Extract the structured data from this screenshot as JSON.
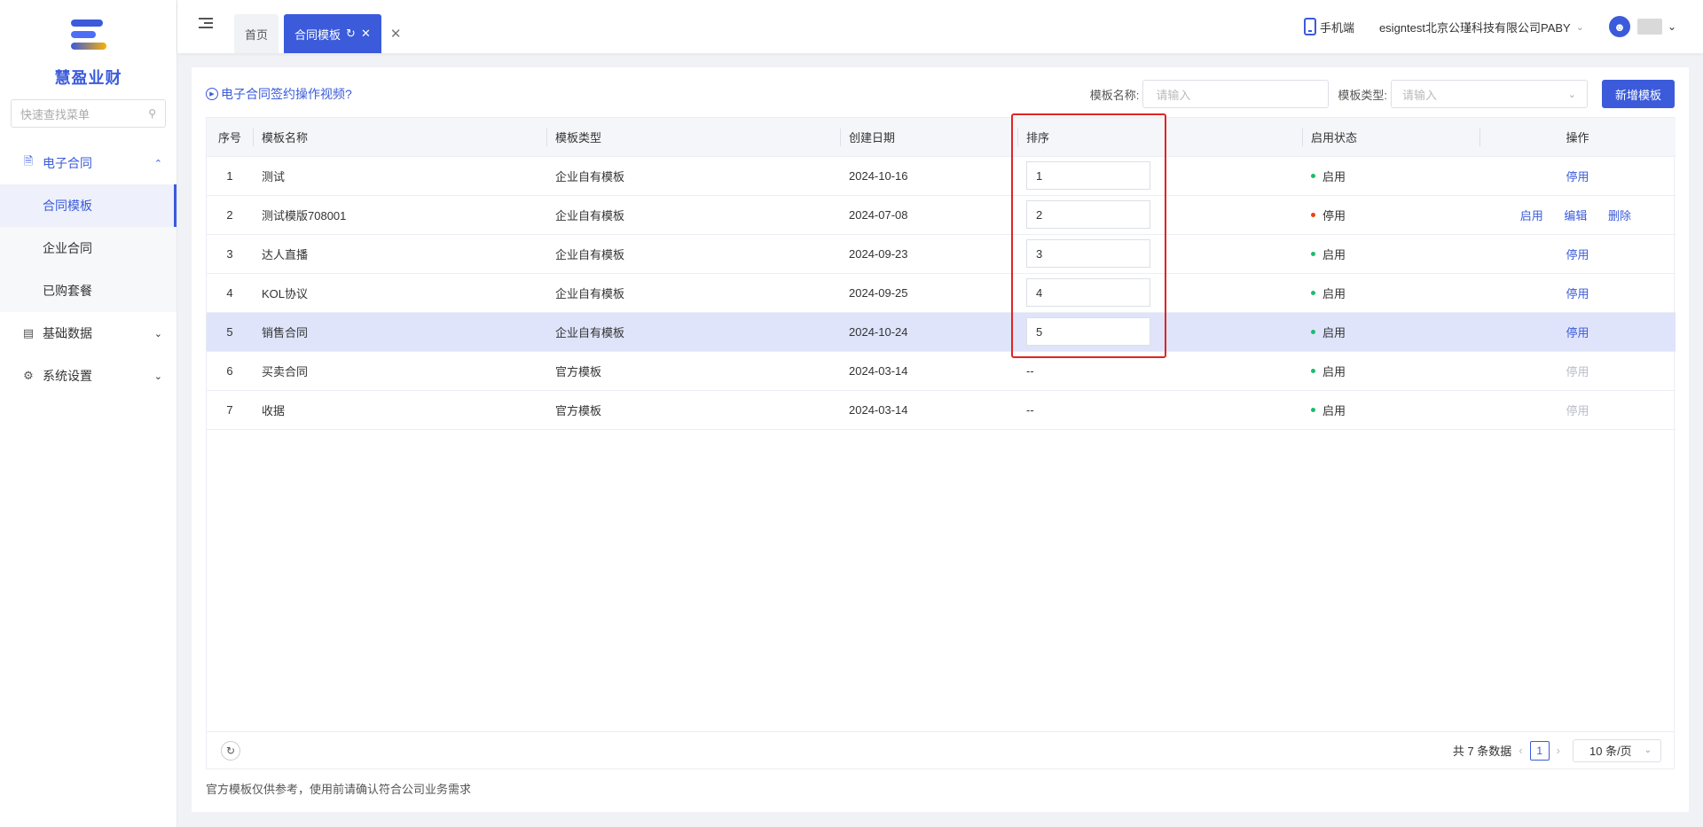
{
  "app": {
    "name": "慧盈业财",
    "search_placeholder": "快速查找菜单"
  },
  "sidebar": {
    "items": [
      {
        "label": "电子合同",
        "icon": "contract-icon",
        "open": true,
        "children": [
          {
            "label": "合同模板",
            "active": true
          },
          {
            "label": "企业合同"
          },
          {
            "label": "已购套餐"
          }
        ]
      },
      {
        "label": "基础数据",
        "icon": "document-icon",
        "open": false
      },
      {
        "label": "系统设置",
        "icon": "gear-icon",
        "open": false
      }
    ]
  },
  "header": {
    "tabs": [
      {
        "label": "首页"
      },
      {
        "label": "合同模板",
        "active": true
      }
    ],
    "mobile_label": "手机端",
    "company": "esigntest北京公瑾科技有限公司PABY"
  },
  "toolbar": {
    "video_link": "电子合同签约操作视频?",
    "name_label": "模板名称:",
    "name_placeholder": "请输入",
    "type_label": "模板类型:",
    "type_placeholder": "请输入",
    "add_button": "新增模板"
  },
  "table": {
    "columns": [
      "序号",
      "模板名称",
      "模板类型",
      "创建日期",
      "排序",
      "启用状态",
      "操作"
    ],
    "rows": [
      {
        "index": "1",
        "name": "测试",
        "type": "企业自有模板",
        "date": "2024-10-16",
        "sort": "1",
        "status": "启用",
        "status_color": "#19be6b"
      },
      {
        "index": "2",
        "name": "测试模版708001",
        "type": "企业自有模板",
        "date": "2024-07-08",
        "sort": "2",
        "status": "停用",
        "status_color": "#ed4014"
      },
      {
        "index": "3",
        "name": "达人直播",
        "type": "企业自有模板",
        "date": "2024-09-23",
        "sort": "3",
        "status": "启用",
        "status_color": "#19be6b"
      },
      {
        "index": "4",
        "name": "KOL协议",
        "type": "企业自有模板",
        "date": "2024-09-25",
        "sort": "4",
        "status": "启用",
        "status_color": "#19be6b"
      },
      {
        "index": "5",
        "name": "销售合同",
        "type": "企业自有模板",
        "date": "2024-10-24",
        "sort": "5",
        "status": "启用",
        "status_color": "#19be6b"
      },
      {
        "index": "6",
        "name": "买卖合同",
        "type": "官方模板",
        "date": "2024-03-14",
        "sort": "--",
        "status": "启用",
        "status_color": "#19be6b"
      },
      {
        "index": "7",
        "name": "收据",
        "type": "官方模板",
        "date": "2024-03-14",
        "sort": "--",
        "status": "启用",
        "status_color": "#19be6b"
      }
    ],
    "actions": {
      "enable": "启用",
      "edit": "编辑",
      "delete": "删除",
      "disable": "停用"
    }
  },
  "pager": {
    "total_text": "共 7 条数据",
    "current_page": "1",
    "page_size": "10 条/页"
  },
  "footnote": "官方模板仅供参考，使用前请确认符合公司业务需求",
  "colors": {
    "accent": "#3b5bdb",
    "highlight_row": "#dfe4fa",
    "annotation_box": "#e02424"
  }
}
